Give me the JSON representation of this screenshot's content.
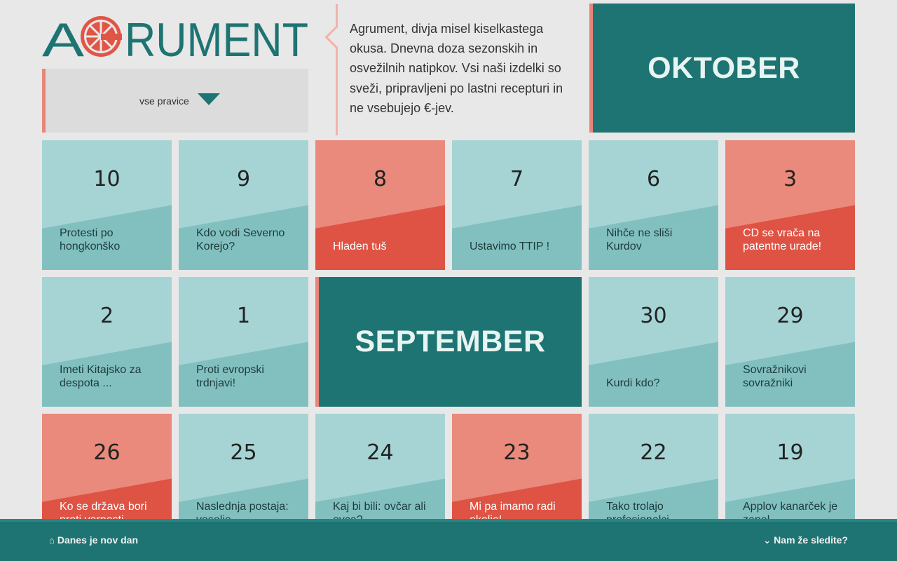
{
  "brand": {
    "logo_text": "AGRUMENT",
    "logo_colors": {
      "teal": "#1e7472",
      "orange": "#e05545"
    }
  },
  "filter": {
    "label": "vse pravice",
    "icon": "triangle-down-icon"
  },
  "description": "Agrument, divja misel kiselkastega okusa. Dnevna doza sezonskih in osvežilnih natipkov. Vsi naši izdelki so sveži, pripravljeni po lastni recepturi in ne vsebujejo €-jev.",
  "months": {
    "october": "OKTOBER",
    "september": "SEPTEMBER"
  },
  "colors": {
    "teal_dark": "#1e7472",
    "teal_light": "#a6d4d4",
    "teal_mid": "#82c0c0",
    "red_light": "#e98a7c",
    "red_dark": "#df5344",
    "accent_pink": "#e8857a"
  },
  "tiles": [
    {
      "day": "10",
      "title": "Protesti po hongkonško",
      "color": "teal"
    },
    {
      "day": "9",
      "title": "Kdo vodi Severno Korejo?",
      "color": "teal"
    },
    {
      "day": "8",
      "title": "Hladen tuš",
      "color": "red"
    },
    {
      "day": "7",
      "title": "Ustavimo TTIP !",
      "color": "teal"
    },
    {
      "day": "6",
      "title": "Nihče ne sliši Kurdov",
      "color": "teal"
    },
    {
      "day": "3",
      "title": "CD se vrača na patentne urade!",
      "color": "red"
    },
    {
      "day": "2",
      "title": "Imeti Kitajsko za despota ...",
      "color": "teal"
    },
    {
      "day": "1",
      "title": "Proti evropski trdnjavi!",
      "color": "teal"
    },
    {
      "day": "30",
      "title": "Kurdi kdo?",
      "color": "teal"
    },
    {
      "day": "29",
      "title": "Sovražnikovi sovražniki",
      "color": "teal"
    },
    {
      "day": "26",
      "title": "Ko se država bori proti varnosti",
      "color": "red"
    },
    {
      "day": "25",
      "title": "Naslednja postaja: veselje",
      "color": "teal"
    },
    {
      "day": "24",
      "title": "Kaj bi bili: ovčar ali ovca?",
      "color": "teal"
    },
    {
      "day": "23",
      "title": "Mi pa imamo radi okolje!",
      "color": "red"
    },
    {
      "day": "22",
      "title": "Tako trolajo profesionalci",
      "color": "teal"
    },
    {
      "day": "19",
      "title": "Applov kanarček je zapel",
      "color": "teal"
    }
  ],
  "footer": {
    "left_label": "Danes je nov dan",
    "left_icon": "home-icon",
    "right_label": "Nam že sledite?",
    "right_icon": "chevron-down-icon"
  }
}
